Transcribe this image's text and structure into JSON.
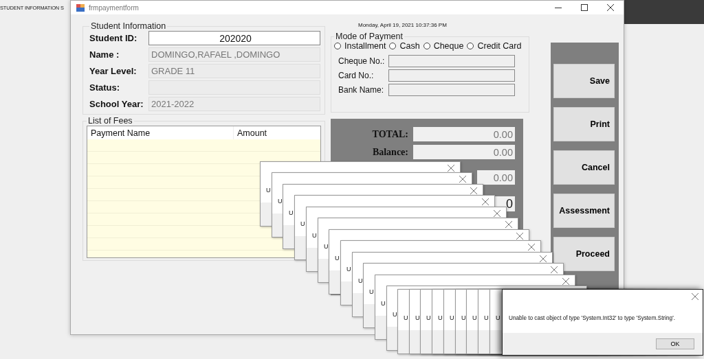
{
  "background_window": {
    "title": "STUDENT INFORMATION S"
  },
  "window": {
    "title": "frmpaymentform"
  },
  "date_time": "Monday, April 19, 2021 10:37:36 PM",
  "student_information": {
    "title": "Student Information",
    "fields": [
      {
        "label": "Student ID:",
        "value": "202020",
        "kind": "input"
      },
      {
        "label": "Name :",
        "value": "DOMINGO,RAFAEL ,DOMINGO",
        "kind": "readonly"
      },
      {
        "label": "Year Level:",
        "value": "GRADE 11",
        "kind": "readonly"
      },
      {
        "label": "Status:",
        "kind": "readonly"
      },
      {
        "label": "School Year:",
        "value": "2021-2022",
        "kind": "readonly"
      }
    ]
  },
  "list_of_fees": {
    "title": "List of Fees",
    "columns": [
      "Payment Name",
      "Amount"
    ]
  },
  "mode_of_payment": {
    "title": "Mode of Payment",
    "options": [
      {
        "label": "Installment",
        "selected": false
      },
      {
        "label": "Cash",
        "selected": false
      },
      {
        "label": "Cheque",
        "selected": false
      },
      {
        "label": "Credit Card",
        "selected": false
      }
    ],
    "fields": [
      {
        "label": "Cheque No.:"
      },
      {
        "label": "Card No.:"
      },
      {
        "label": "Bank Name:"
      }
    ]
  },
  "totals": [
    {
      "label": "TOTAL:",
      "value": "0.00",
      "kind": "normal"
    },
    {
      "label": "Balance:",
      "value": "0.00",
      "kind": "normal"
    },
    {
      "value": "0.00",
      "kind": "normal"
    },
    {
      "value": "0",
      "kind": "large"
    }
  ],
  "buttons": [
    "Save",
    "Print",
    "Cancel",
    "Assessment",
    "Proceed"
  ],
  "stacked_dialogs": [
    {
      "text": "U"
    },
    {
      "text": "U"
    },
    {
      "text": "U"
    },
    {
      "text": "U"
    },
    {
      "text": "U"
    },
    {
      "text": "U"
    },
    {
      "text": "U"
    },
    {
      "text": "U"
    },
    {
      "text": "U"
    },
    {
      "text": "U"
    },
    {
      "text": "U"
    },
    {
      "text": "U"
    },
    {
      "text": "U"
    },
    {
      "text": "U"
    },
    {
      "text": "U"
    },
    {
      "text": "U"
    },
    {
      "text": "U"
    },
    {
      "text": "U"
    },
    {
      "text": "U"
    },
    {
      "text": "U"
    },
    {
      "text": "U"
    }
  ],
  "error_dialog": {
    "message": "Unable to cast object of type 'System.Int32' to type 'System.String'.",
    "button": "OK"
  }
}
